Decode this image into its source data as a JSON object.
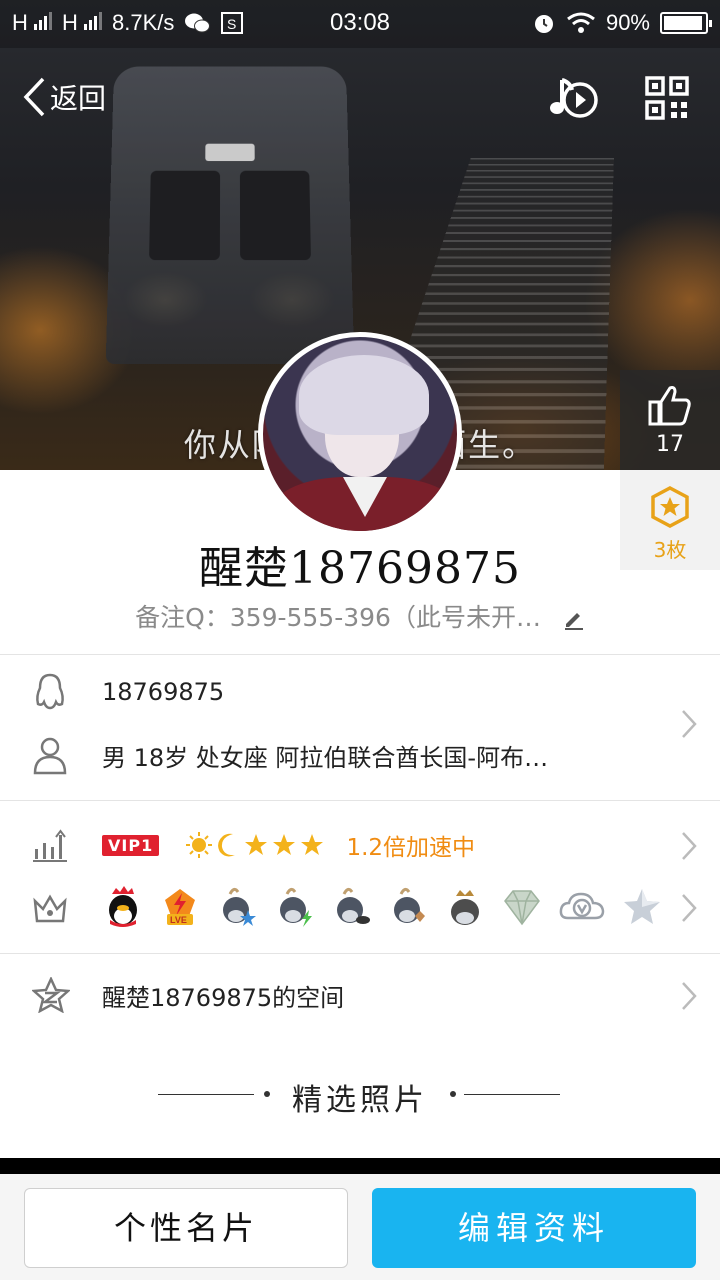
{
  "status_bar": {
    "signal1": "H",
    "signal2": "H",
    "net_speed": "8.7K/s",
    "time": "03:08",
    "battery": "90%"
  },
  "nav": {
    "back_label": "返回"
  },
  "cover": {
    "subtitle": "你从陌生走      走向陌生。"
  },
  "likes": {
    "count": "17"
  },
  "medals": {
    "count": "3枚"
  },
  "profile": {
    "nickname": "醒楚18769875",
    "remark": "备注Q：359-555-396（此号未开…"
  },
  "info": {
    "qq_number": "18769875",
    "details": "男  18岁  处女座  阿拉伯联合酋长国-阿布…"
  },
  "vip": {
    "badge": "VIP1",
    "speedup": "1.2倍加速中"
  },
  "space": {
    "label": "醒楚18769875的空间"
  },
  "photos": {
    "title": "精选照片"
  },
  "buttons": {
    "card": "个性名片",
    "edit": "编辑资料"
  },
  "colors": {
    "accent_blue": "#19b4f0",
    "vip_red": "#e0212f",
    "speedup_orange": "#f08c12",
    "medal_gold": "#e8a218"
  }
}
